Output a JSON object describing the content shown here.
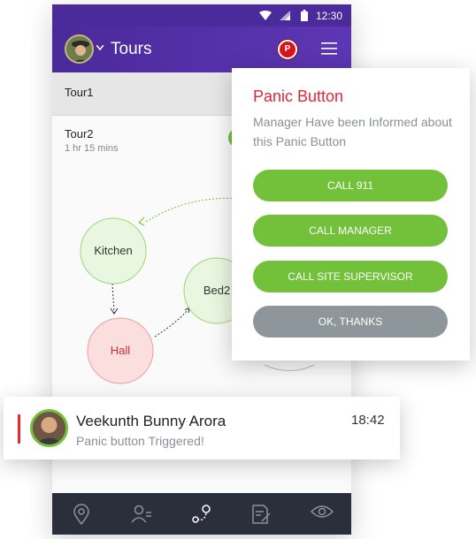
{
  "status_bar": {
    "time": "12:30"
  },
  "app_bar": {
    "title": "Tours",
    "panic_badge": "P"
  },
  "tours": [
    {
      "name": "Tour1"
    },
    {
      "name": "Tour2",
      "duration": "1 hr 15 mins"
    }
  ],
  "map": {
    "nodes": [
      {
        "label": "Kitchen",
        "color": "#73c13b"
      },
      {
        "label": "Bed2",
        "color": "#73c13b"
      },
      {
        "label": "Hall",
        "color": "#e2263a"
      }
    ]
  },
  "dialog": {
    "title": "Panic Button",
    "message": "Manager Have been Informed about this Panic Button",
    "buttons": [
      "CALL 911",
      "CALL MANAGER",
      "CALL SITE SUPERVISOR",
      "OK, THANKS"
    ]
  },
  "notification": {
    "name": "Veekunth Bunny Arora",
    "message": "Panic button Triggered!",
    "time": "18:42"
  },
  "bottom_nav": [
    {
      "icon": "location-pin-icon"
    },
    {
      "icon": "user-list-icon"
    },
    {
      "icon": "route-icon"
    },
    {
      "icon": "report-edit-icon"
    },
    {
      "icon": "eye-icon"
    }
  ],
  "colors": {
    "primary": "#4b2b9c",
    "accent_green": "#73c13b",
    "alert_red": "#e2263a",
    "nav_dark": "#2a2f3b"
  }
}
